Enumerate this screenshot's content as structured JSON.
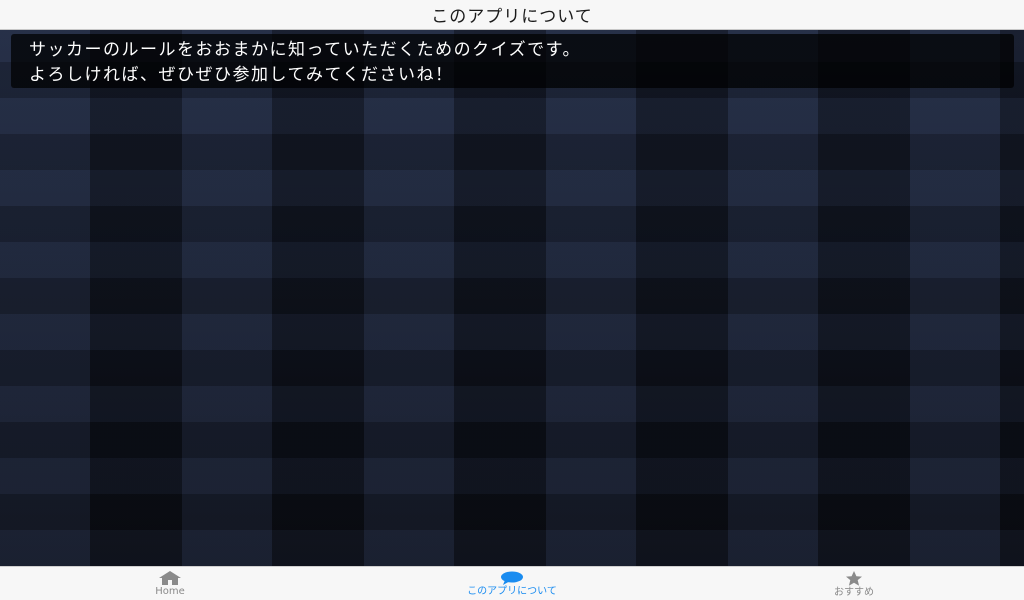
{
  "nav": {
    "title": "このアプリについて"
  },
  "message": {
    "lines": [
      "サッカーのルールをおおまかに知っていただくためのクイズです。",
      "よろしければ、ぜひぜひ参加してみてくださいね！"
    ]
  },
  "tabs": [
    {
      "label": "Home",
      "icon": "home-icon",
      "active": false
    },
    {
      "label": "このアプリについて",
      "icon": "speech-bubble-icon",
      "active": true
    },
    {
      "label": "おすすめ",
      "icon": "star-icon",
      "active": false
    }
  ],
  "colors": {
    "accent": "#1a8cf0",
    "inactive": "#8a8a8a",
    "bar_background": "#f7f7f7",
    "content_background": "#141a28"
  }
}
